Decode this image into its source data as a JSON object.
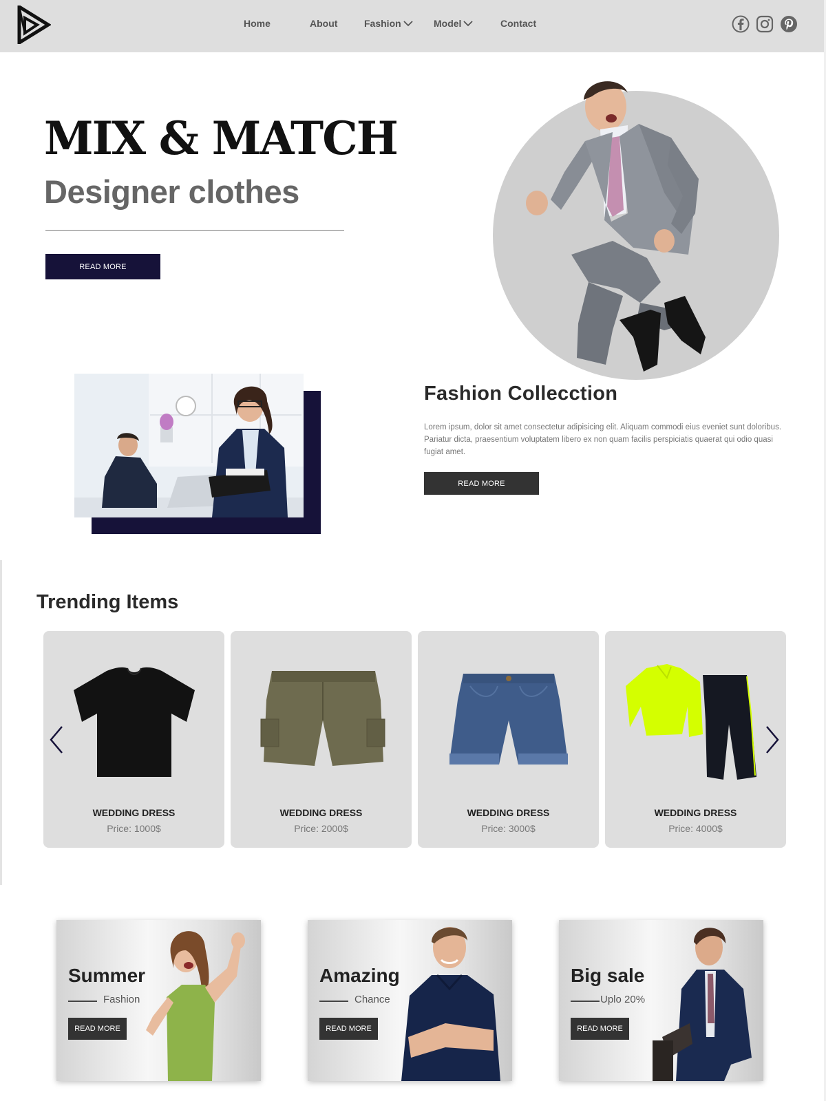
{
  "nav": {
    "items": [
      {
        "label": "Home",
        "dropdown": false
      },
      {
        "label": "About",
        "dropdown": false
      },
      {
        "label": "Fashion",
        "dropdown": true
      },
      {
        "label": "Model",
        "dropdown": true
      },
      {
        "label": "Contact",
        "dropdown": false
      }
    ],
    "social_icons": [
      "facebook-icon",
      "instagram-icon",
      "pinterest-icon"
    ]
  },
  "hero": {
    "title": "MIX & MATCH",
    "subtitle": "Designer clothes",
    "button_label": "READ MORE"
  },
  "collection": {
    "title": "Fashion Collecction",
    "text": "Lorem ipsum, dolor sit amet consectetur adipisicing elit. Aliquam commodi eius eveniet sunt doloribus. Pariatur dicta, praesentium voluptatem libero ex non quam facilis perspiciatis quaerat qui odio quasi fugiat amet.",
    "button_label": "READ MORE"
  },
  "trending": {
    "title": "Trending Items",
    "items": [
      {
        "name": "WEDDING DRESS",
        "price": "Price: 1000$",
        "image": "black-tshirt"
      },
      {
        "name": "WEDDING DRESS",
        "price": "Price: 2000$",
        "image": "olive-cargo-shorts"
      },
      {
        "name": "WEDDING DRESS",
        "price": "Price: 3000$",
        "image": "denim-shorts"
      },
      {
        "name": "WEDDING DRESS",
        "price": "Price: 4000$",
        "image": "neon-tracksuit"
      }
    ]
  },
  "promos": [
    {
      "title": "Summer",
      "subtitle": "Fashion",
      "button_label": "READ MORE"
    },
    {
      "title": "Amazing",
      "subtitle": "Chance",
      "button_label": "READ MORE"
    },
    {
      "title": "Big sale",
      "subtitle": "Uplo 20%",
      "button_label": "READ MORE"
    }
  ],
  "colors": {
    "header_bg": "#dedede",
    "navy": "#161239",
    "dark_button": "#333333",
    "card_bg": "#dedede",
    "hero_circle": "#cfcfcf",
    "neon": "#d4ff00"
  }
}
